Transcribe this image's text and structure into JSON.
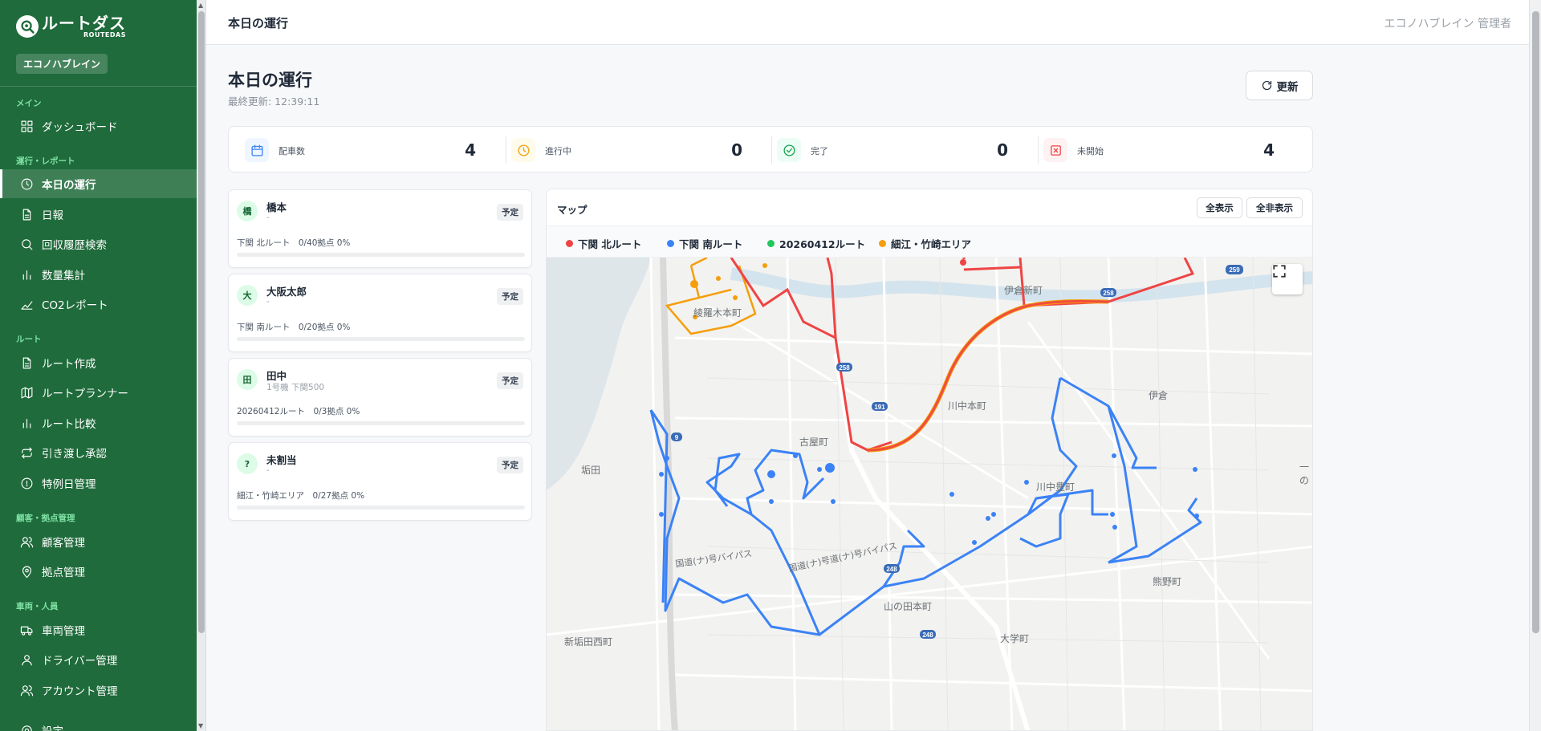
{
  "brand": {
    "name_jp": "ルートダス",
    "name_en": "ROUTEDAS",
    "tenant": "エコノハブレイン"
  },
  "sidebar": {
    "sections": [
      {
        "label": "メイン",
        "items": [
          {
            "label": "ダッシュボード",
            "icon": "grid-icon"
          }
        ]
      },
      {
        "label": "運行・レポート",
        "items": [
          {
            "label": "本日の運行",
            "icon": "clock-icon",
            "active": true
          },
          {
            "label": "日報",
            "icon": "document-icon"
          },
          {
            "label": "回収履歴検索",
            "icon": "search-icon"
          },
          {
            "label": "数量集計",
            "icon": "bar-chart-icon"
          },
          {
            "label": "CO2レポート",
            "icon": "trend-icon"
          }
        ]
      },
      {
        "label": "ルート",
        "items": [
          {
            "label": "ルート作成",
            "icon": "document-icon"
          },
          {
            "label": "ルートプランナー",
            "icon": "map-icon"
          },
          {
            "label": "ルート比較",
            "icon": "bar-chart-icon"
          },
          {
            "label": "引き渡し承認",
            "icon": "swap-icon"
          },
          {
            "label": "特例日管理",
            "icon": "info-circle-icon"
          }
        ]
      },
      {
        "label": "顧客・拠点管理",
        "items": [
          {
            "label": "顧客管理",
            "icon": "users-icon"
          },
          {
            "label": "拠点管理",
            "icon": "pin-icon"
          }
        ]
      },
      {
        "label": "車両・人員",
        "items": [
          {
            "label": "車両管理",
            "icon": "truck-icon"
          },
          {
            "label": "ドライバー管理",
            "icon": "user-icon"
          },
          {
            "label": "アカウント管理",
            "icon": "users-icon"
          }
        ]
      }
    ],
    "partial_item": "設定"
  },
  "topbar": {
    "title": "本日の運行",
    "user": "エコノハブレイン 管理者"
  },
  "page": {
    "title": "本日の運行",
    "last_update": "最終更新: 12:39:11",
    "refresh_label": "更新"
  },
  "stats": [
    {
      "label": "配車数",
      "value": "4",
      "icon": "calendar-icon",
      "color": "#3b82f6",
      "bg": "#eff6ff"
    },
    {
      "label": "進行中",
      "value": "0",
      "icon": "clock-icon",
      "color": "#f59e0b",
      "bg": "#fffbeb"
    },
    {
      "label": "完了",
      "value": "0",
      "icon": "check-circle-icon",
      "color": "#16a34a",
      "bg": "#ecfdf5"
    },
    {
      "label": "未開始",
      "value": "4",
      "icon": "x-square-icon",
      "color": "#ef4444",
      "bg": "#fef2f2"
    }
  ],
  "vehicles": [
    {
      "avatar": "橋",
      "name": "橋本",
      "sub": "-",
      "badge": "予定",
      "route": "下関 北ルート　0/40拠点 0%",
      "progress": 0
    },
    {
      "avatar": "大",
      "name": "大阪太郎",
      "sub": "-",
      "badge": "予定",
      "route": "下関 南ルート　0/20拠点 0%",
      "progress": 0
    },
    {
      "avatar": "田",
      "name": "田中",
      "sub": "1号機 下関500",
      "badge": "予定",
      "route": "20260412ルート　0/3拠点 0%",
      "progress": 0
    },
    {
      "avatar": "?",
      "name": "未割当",
      "sub": "-",
      "badge": "予定",
      "route": "細江・竹崎エリア　0/27拠点 0%",
      "progress": 0
    }
  ],
  "map": {
    "title": "マップ",
    "show_all": "全表示",
    "hide_all": "全非表示",
    "legend": [
      {
        "label": "下関 北ルート",
        "color": "#ef4444"
      },
      {
        "label": "下関 南ルート",
        "color": "#3b82f6"
      },
      {
        "label": "20260412ルート",
        "color": "#22c55e"
      },
      {
        "label": "細江・竹崎エリア",
        "color": "#f59e0b"
      }
    ],
    "places": [
      "伊倉新町",
      "綾羅木本町",
      "川中本町",
      "伊倉",
      "古屋町",
      "垢田",
      "川中豊町",
      "一の",
      "山の田本町",
      "熊野町",
      "新垢田西町",
      "大学町",
      "国道(ナ)号バイパス",
      "国道(ナ)号道(ナ)号バイパス"
    ],
    "road_shields": [
      "259",
      "258",
      "258",
      "9",
      "248",
      "248",
      "191"
    ]
  }
}
